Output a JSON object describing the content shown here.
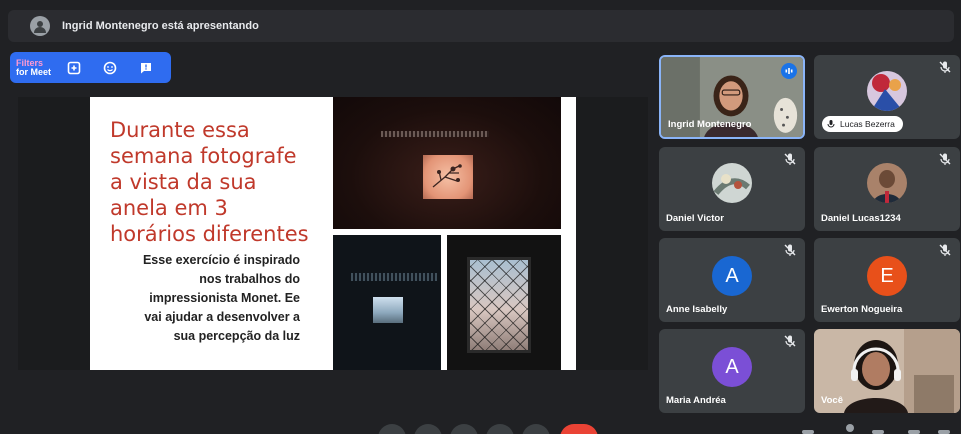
{
  "banner": {
    "text": "Ingrid Montenegro está apresentando"
  },
  "filters": {
    "brand_line1": "Filters",
    "brand_line2": "for Meet",
    "icons": [
      "add-frame-icon",
      "sticker-icon",
      "chat-icon"
    ]
  },
  "slide": {
    "title_lines": [
      "Durante essa",
      "semana fotografe",
      "a vista da sua",
      "anela em 3",
      "horários diferentes"
    ],
    "body_lines": [
      "Esse exercício é inspirado",
      "nos trabalhos do",
      "impressionista Monet. Ee",
      "vai ajudar a desenvolver a",
      "sua percepção da luz"
    ],
    "title_color": "#c0392b"
  },
  "participants": [
    {
      "name": "Ingrid Montenegro",
      "state": "speaking"
    },
    {
      "name": "Lucas Bezerra",
      "state": "muted"
    },
    {
      "name": "Daniel Victor",
      "state": "muted"
    },
    {
      "name": "Daniel Lucas1234",
      "state": "muted"
    },
    {
      "name": "Anne Isabelly",
      "state": "muted",
      "initial": "A",
      "avatar_color": "#1967d2"
    },
    {
      "name": "Ewerton Nogueira",
      "state": "muted",
      "initial": "E",
      "avatar_color": "#e8501a"
    },
    {
      "name": "Maria Andréa",
      "state": "muted",
      "initial": "A",
      "avatar_color": "#7b4fd6"
    },
    {
      "name": "Você",
      "state": "camera"
    }
  ],
  "colors": {
    "accent": "#8ab4f8",
    "filters_bg": "#2f6cf0",
    "end_call": "#ea4335"
  }
}
